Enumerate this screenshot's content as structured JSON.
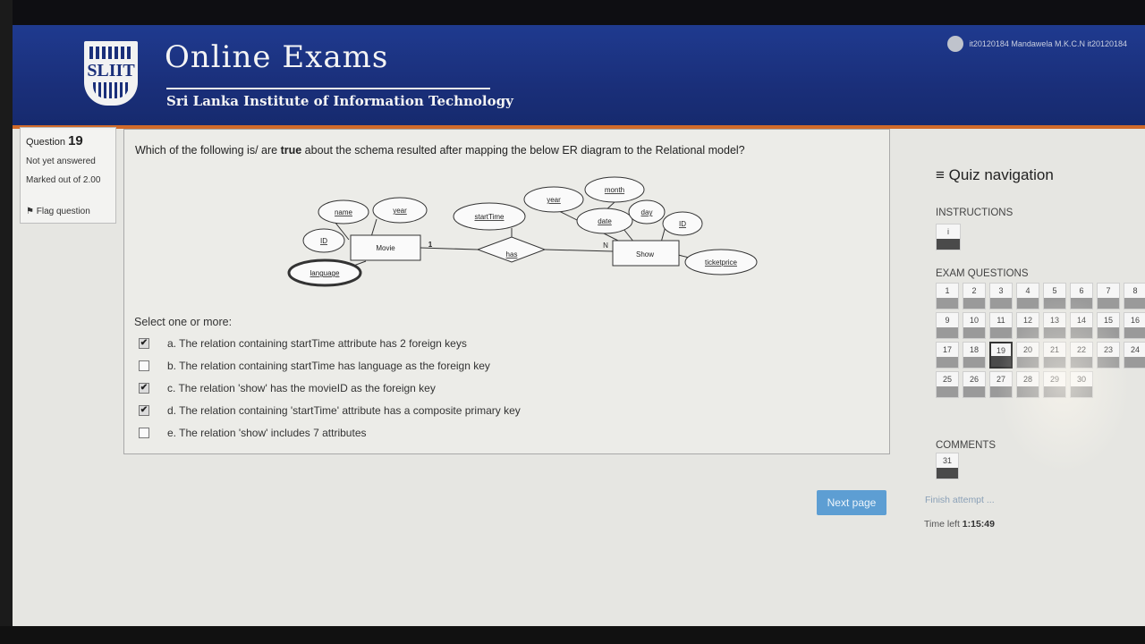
{
  "header": {
    "logo_text": "SLIIT",
    "title": "Online Exams",
    "subtitle": "Sri Lanka Institute of Information Technology",
    "user": "it20120184 Mandawela M.K.C.N it20120184"
  },
  "question_info": {
    "label": "Question",
    "number": "19",
    "state": "Not yet answered",
    "marks": "Marked out of 2.00",
    "flag": "Flag question"
  },
  "question": {
    "text_before": "Which of the following is/ are ",
    "text_bold": "true",
    "text_after": " about the schema resulted after mapping the below ER diagram to the Relational model?",
    "select_label": "Select one or more:",
    "options": [
      {
        "text": "a. The relation containing startTime attribute has 2 foreign keys",
        "checked": true
      },
      {
        "text": "b. The relation containing startTime has language as the foreign key",
        "checked": false
      },
      {
        "text": "c. The relation 'show' has the movieID as the foreign key",
        "checked": true
      },
      {
        "text": "d. The relation containing 'startTime' attribute has a composite primary key",
        "checked": true
      },
      {
        "text": "e. The relation 'show' includes 7 attributes",
        "checked": false
      }
    ]
  },
  "er_diagram": {
    "entity_movie": "Movie",
    "entity_show": "Show",
    "relationship": "has",
    "card_movie": "1",
    "card_show": "N",
    "attr_name": "name",
    "attr_movie_year": "year",
    "attr_movie_id": "ID",
    "attr_language": "language",
    "attr_starttime": "startTime",
    "attr_show_year": "year",
    "attr_month": "month",
    "attr_date": "date",
    "attr_day": "day",
    "attr_show_id": "ID",
    "attr_ticketprice": "ticketprice"
  },
  "navigation": {
    "title": "Quiz navigation",
    "instructions_label": "INSTRUCTIONS",
    "instructions_button": "i",
    "exam_questions_label": "EXAM QUESTIONS",
    "comments_label": "COMMENTS",
    "questions": [
      "1",
      "2",
      "3",
      "4",
      "5",
      "6",
      "7",
      "8",
      "9",
      "10",
      "11",
      "12",
      "13",
      "14",
      "15",
      "16",
      "17",
      "18",
      "19",
      "20",
      "21",
      "22",
      "23",
      "24",
      "25",
      "26",
      "27",
      "28",
      "29",
      "30"
    ],
    "answered": [
      "1",
      "2",
      "3",
      "4",
      "5",
      "6",
      "7",
      "8",
      "9",
      "10",
      "11",
      "12",
      "13",
      "14",
      "15",
      "16",
      "17",
      "18",
      "20",
      "21",
      "22",
      "23",
      "24",
      "25",
      "26",
      "27",
      "28",
      "29",
      "30"
    ],
    "current": "19",
    "comment_items": [
      "31"
    ],
    "next_button": "Next page",
    "finish": "Finish attempt ...",
    "time_label": "Time left",
    "time_value": "1:15:49"
  },
  "colors": {
    "header_blue": "#1a2f7a",
    "accent_orange": "#d06a2a",
    "next_button": "#5d9ed3"
  }
}
